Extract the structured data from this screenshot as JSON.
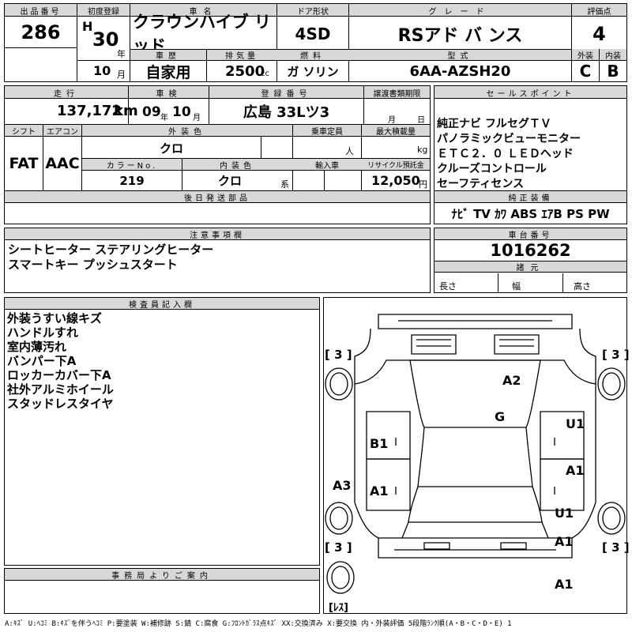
{
  "top": {
    "lot_no_label": "出品番号",
    "lot_no": "286",
    "first_reg_label": "初度登録",
    "era": "H",
    "year": "30",
    "year_unit": "年",
    "month": "10",
    "month_unit": "月",
    "car_name_label": "車名",
    "car_name": "クラウンハイブ リッド",
    "door_label": "ドア形状",
    "door": "4SD",
    "grade_label": "グレード",
    "grade": "RSアド バ ンス",
    "score_label": "評価点",
    "score": "4",
    "history_label": "車歴",
    "history": "自家用",
    "disp_label": "排気量",
    "disp": "2500",
    "disp_unit": "cc",
    "fuel_label": "燃料",
    "fuel": "ガ ソリン",
    "model_label": "型式",
    "model": "6AA-AZSH20",
    "ext_label": "外装",
    "ext": "C",
    "int_label": "内装",
    "int": "B"
  },
  "row2": {
    "mileage_label": "走行",
    "mileage": "137,172",
    "mileage_unit": "km",
    "inspection_label": "車検",
    "insp_year": "09",
    "insp_year_unit": "年",
    "insp_month": "10",
    "insp_month_unit": "月",
    "reg_no_label": "登録番号",
    "reg_no": "広島 33Lツ3",
    "transfer_label": "譲渡書類期限",
    "transfer_month_unit": "月",
    "transfer_day_unit": "日",
    "shift_label": "シフト",
    "shift": "FAT",
    "ac_label": "エアコン",
    "ac": "AAC",
    "ext_color_label": "外装色",
    "ext_color": "クロ",
    "capacity_label": "乗車定員",
    "capacity_unit": "人",
    "load_label": "最大積載量",
    "load_unit": "kg",
    "color_no_label": "カラーNo.",
    "color_no": "219",
    "int_color_label": "内装色",
    "int_color": "クロ",
    "int_color_unit": "系",
    "import_label": "輸入車",
    "recycle_label": "リサイクル預託金",
    "recycle": "12,050",
    "recycle_unit": "円",
    "later_parts_label": "後日発送部品"
  },
  "sales": {
    "label": "セールスポイント",
    "lines": [
      "純正ナビ フルセグＴＶ",
      "パノラミックビューモニター",
      "ＥＴＣ２．０ ＬＥＤヘッド",
      "クルーズコントロール",
      "セーフティセンス"
    ],
    "equip_label": "純正装備",
    "equip": "ﾅﾋﾞ TV ｶﾜ ABS ｴｱB PS PW"
  },
  "notes": {
    "label": "注意事項欄",
    "lines": [
      "シートヒーター ステアリングヒーター",
      "スマートキー プッシュスタート"
    ]
  },
  "chassis": {
    "label": "車台番号",
    "value": "1016262",
    "specs_label": "諸元",
    "length_label": "長さ",
    "width_label": "幅",
    "height_label": "高さ"
  },
  "inspector": {
    "label": "検査員記入欄",
    "lines": [
      "外装うすい線キズ",
      "ハンドルすれ",
      "室内薄汚れ",
      "バンパー下A",
      "ロッカーカバー下A",
      "社外アルミホイール",
      "スタッドレスタイヤ"
    ]
  },
  "diagram": {
    "tire_left_front": "[ 3 ]",
    "tire_right_front": "[ 3 ]",
    "tire_left_rear": "[ 3 ]",
    "tire_right_rear": "[ 3 ]",
    "spare": "[ﾚｽ]",
    "marks": {
      "a2": "A2",
      "g": "G",
      "u1_right": "U1",
      "b1": "B1",
      "a1_right": "A1",
      "a3": "A3",
      "a1_left": "A1",
      "u1_right2": "U1",
      "a1_rear": "A1",
      "a1_bottom": "A1"
    }
  },
  "office": {
    "label": "事務局よりご案内"
  },
  "legend": "A:ｷｽﾞ U:ﾍｺﾐ B:ｷｽﾞを伴うﾍｺﾐ P:要塗装 W:補修跡 S:錆 C:腐食 G:ﾌﾛﾝﾄｶﾞﾗｽ点ｷｽﾞ XX:交換済み X:要交換 内・外装評価 5段階ﾗﾝｸ順(A・B・C・D・E) 1"
}
